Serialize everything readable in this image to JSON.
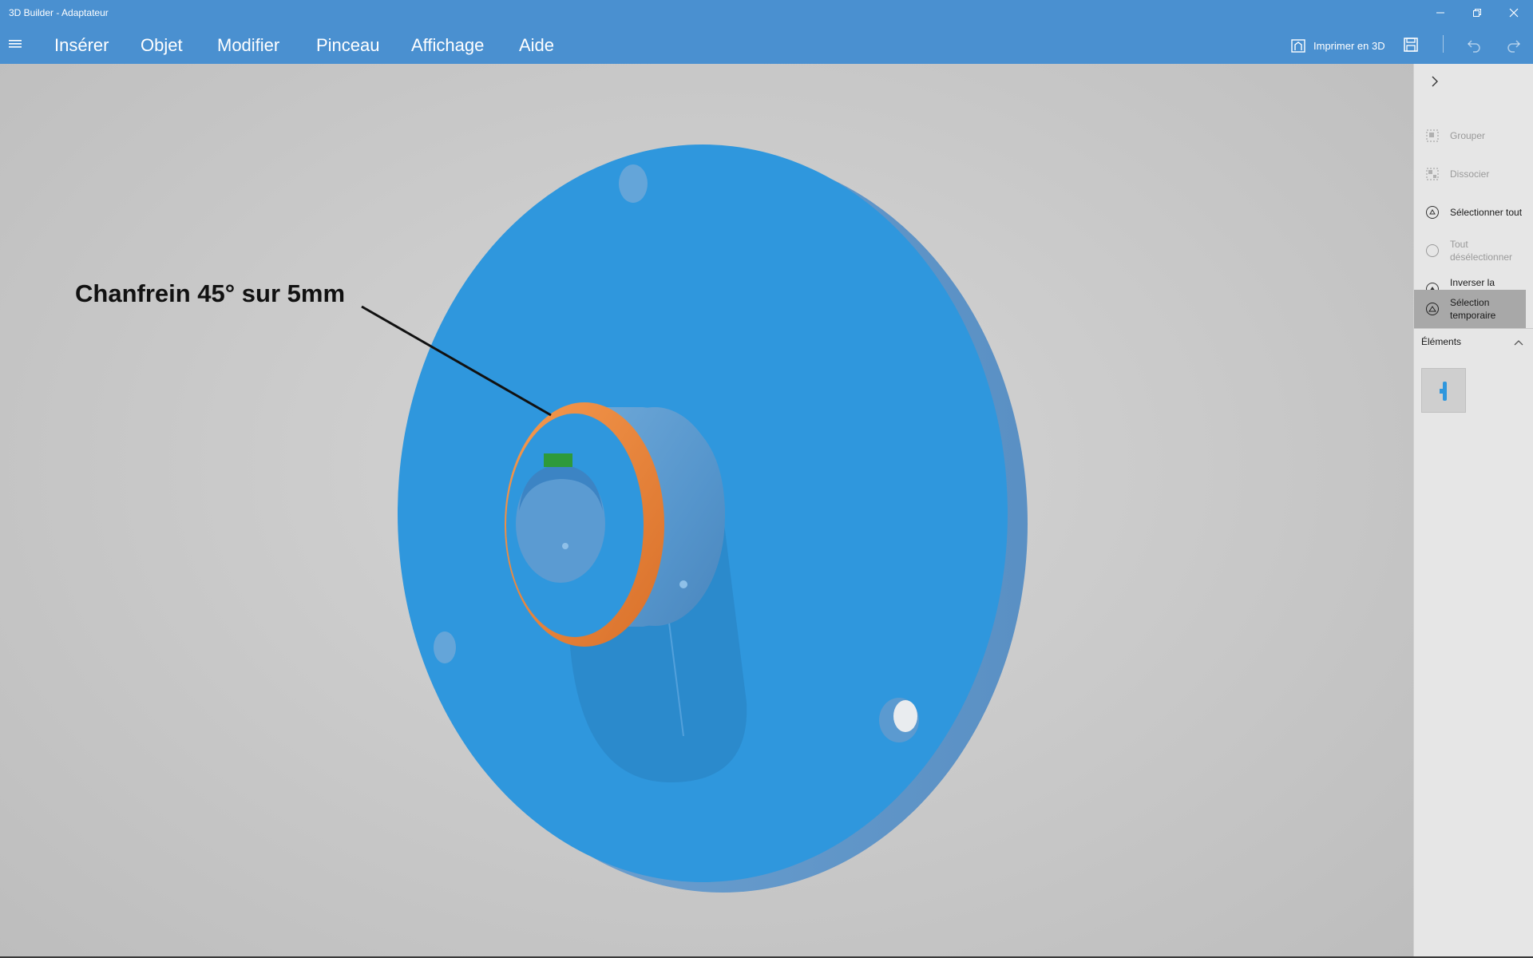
{
  "window": {
    "title": "3D Builder - Adaptateur",
    "buttons": [
      "minimize-icon",
      "restore-icon",
      "close-icon"
    ]
  },
  "menu": {
    "items": [
      "Insérer",
      "Objet",
      "Modifier",
      "Pinceau",
      "Affichage",
      "Aide"
    ],
    "print_label": "Imprimer en 3D"
  },
  "annotation": {
    "text": "Chanfrein 45° sur 5mm"
  },
  "panel": {
    "commands": [
      {
        "label": "Grouper",
        "icon": "group-icon",
        "state": "disabled"
      },
      {
        "label": "Dissocier",
        "icon": "ungroup-icon",
        "state": "disabled"
      },
      {
        "label": "Sélectionner tout",
        "icon": "select-all-icon",
        "state": "enabled"
      },
      {
        "label": "Tout désélectionner",
        "icon": "deselect-all-icon",
        "state": "disabled"
      },
      {
        "label": "Inverser la sélection",
        "icon": "invert-selection-icon",
        "state": "enabled"
      },
      {
        "label": "Sélection temporaire",
        "icon": "temporary-selection-icon",
        "state": "active"
      }
    ],
    "section_title": "Éléments"
  },
  "colors": {
    "accent": "#4a90d0",
    "model_blue": "#2f97dd",
    "chamfer_orange": "#f08a3c",
    "marker_green": "#2e9a3a"
  }
}
